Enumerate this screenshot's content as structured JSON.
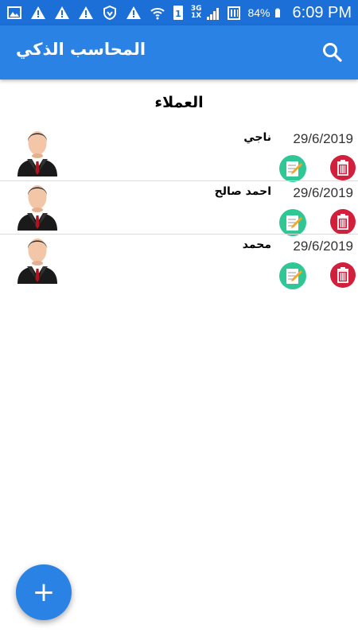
{
  "status_bar": {
    "network_labels": [
      "3G",
      "1X"
    ],
    "battery": "84%",
    "time": "6:09 PM",
    "icons": [
      "gallery-icon",
      "warning-icon",
      "warning-icon",
      "warning-icon",
      "shield-icon",
      "warning-icon",
      "wifi-icon",
      "sim-icon",
      "signal-icon",
      "data-icon",
      "battery-icon"
    ]
  },
  "app_bar": {
    "title": "المحاسب الذكي",
    "search_icon": "search-icon",
    "color": "#2a82e4"
  },
  "section": {
    "title": "العملاء"
  },
  "customers": [
    {
      "name": "ناجي",
      "date": "29/6/2019"
    },
    {
      "name": "احمد صالح",
      "date": "29/6/2019"
    },
    {
      "name": "محمد",
      "date": "29/6/2019"
    }
  ],
  "actions": {
    "edit_icon": "edit-icon",
    "delete_icon": "trash-icon",
    "edit_color": "#2ec795",
    "delete_color": "#d21f3c"
  },
  "fab": {
    "label": "+",
    "icon": "plus-icon"
  }
}
